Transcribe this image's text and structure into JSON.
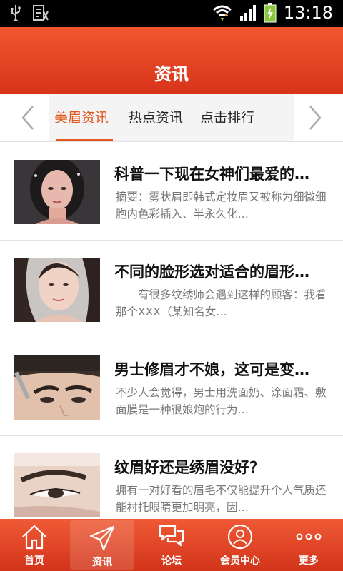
{
  "status_bar": {
    "time": "13:18",
    "cn_badge": "☱"
  },
  "header": {
    "title": "资讯"
  },
  "tabs": [
    {
      "label": "美眉资讯",
      "active": true
    },
    {
      "label": "热点资讯",
      "active": false
    },
    {
      "label": "点击排行",
      "active": false
    }
  ],
  "articles": [
    {
      "title": "科普一下现在女神们最爱的…",
      "summary": "摘要：雾状眉即韩式定妆眉又被称为细微细胞内色彩插入、半永久化…"
    },
    {
      "title": "不同的脸形选对适合的眉形…",
      "summary": "　　有很多纹绣师会遇到这样的顾客：我看那个XXX（某知名女…"
    },
    {
      "title": "男士修眉才不娘，这可是变…",
      "summary": "不少人会觉得，男士用洗面奶、涂面霜、敷面膜是一种很娘炮的行为…"
    },
    {
      "title": "纹眉好还是绣眉没好？",
      "summary": "拥有一对好看的眉毛不仅能提升个人气质还能衬托眼睛更加明亮，因…"
    }
  ],
  "bottom_nav": [
    {
      "label": "首页",
      "icon": "home-icon",
      "active": false
    },
    {
      "label": "资讯",
      "icon": "send-icon",
      "active": true
    },
    {
      "label": "论坛",
      "icon": "chat-icon",
      "active": false
    },
    {
      "label": "会员中心",
      "icon": "user-icon",
      "active": false
    },
    {
      "label": "更多",
      "icon": "more-icon",
      "active": false
    }
  ],
  "colors": {
    "accent": "#e2561f",
    "header": "#e4421f"
  }
}
